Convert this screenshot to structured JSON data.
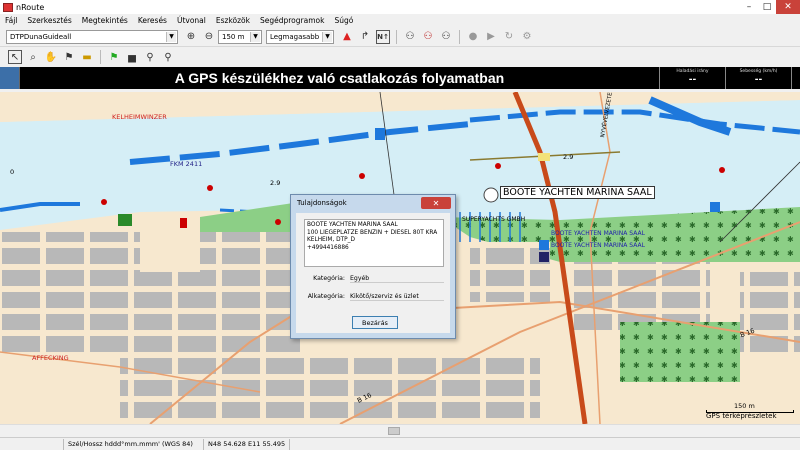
{
  "window": {
    "title": "nRoute"
  },
  "menu": [
    "Fájl",
    "Szerkesztés",
    "Megtekintés",
    "Keresés",
    "Útvonal",
    "Eszközök",
    "Segédprogramok",
    "Súgó"
  ],
  "toolbar": {
    "map_select": "DTPDunaGuideall",
    "zoom_select": "150 m",
    "detail_select": "Legmagasabb"
  },
  "infobar": {
    "status": "A GPS készülékhez való csatlakozás folyamatban",
    "heading_label": "Haladási irány",
    "heading_value": "--",
    "speed_label": "Sebesség (km/h)",
    "speed_value": "--"
  },
  "map": {
    "labels": {
      "kelheimwinzer": "KELHEIMWINZER",
      "fkm": "FKM 2411",
      "depth_29": "2.9",
      "depth_0": "0",
      "depth_29b": "2.9",
      "boote_big": "BOOTE YACHTEN MARINA SAAL",
      "superyachts": "SUPERYACHTS GMBH",
      "boote1": "BOOTE YACHTEN MARINA SAAL",
      "boote2": "BOOTE YACHTEN MARINA SAAL",
      "affecking": "AFFECKING",
      "road_b16a": "B 16",
      "road_b16b": "B 16",
      "vertical_road": "NYVÉVELVEZETES",
      "scale": "150 m",
      "gps": "GPS térképrészletek"
    }
  },
  "dialog": {
    "title": "Tulajdonságok",
    "description": "BOOTE YACHTEN MARINA SAAL\n100 LIEGEPLATZE BENZIN + DIESEL 80T KRA\nKELHEIM, DTP_D\n+4994416886",
    "category_label": "Kategória:",
    "category_value": "Egyéb",
    "subcategory_label": "Alkategória:",
    "subcategory_value": "Kikötő/szerviz és üzlet",
    "close_button": "Bezárás"
  },
  "statusbar": {
    "coord_format": "Szél/Hossz hddd°mm.mmm' (WGS 84)",
    "coords": "N48 54.628 E11 55.495"
  },
  "colors": {
    "water": "#d5eef6",
    "channel": "#1e78dc",
    "land": "#f7e8cf",
    "green": "#8ccf86",
    "gray": "#b8b8b8",
    "road": "#e8a070",
    "main_road": "#c84a1a",
    "status_bg": "#000000"
  }
}
